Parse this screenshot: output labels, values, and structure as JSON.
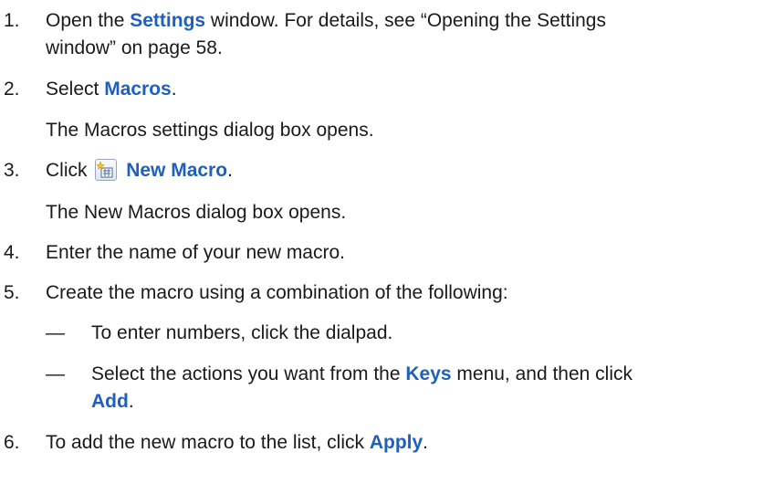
{
  "steps": [
    {
      "number": "1.",
      "pre": "Open the ",
      "ui": "Settings",
      "line1_post": " window. For details, see “Opening the Settings",
      "line2": "window” on page 58."
    },
    {
      "number": "2.",
      "pre": "Select ",
      "ui": "Macros",
      "post": ".",
      "result": "The Macros settings dialog box opens."
    },
    {
      "number": "3.",
      "pre": "Click ",
      "icon": "new-macro-icon",
      "ui": "New Macro",
      "post": ".",
      "result": "The New Macros dialog box opens."
    },
    {
      "number": "4.",
      "text": "Enter the name of your new macro."
    },
    {
      "number": "5.",
      "text": "Create the macro using a combination of the following:",
      "bullets": [
        {
          "dash": "—",
          "text": "To enter numbers, click the dialpad."
        },
        {
          "dash": "—",
          "pre": "Select the actions you want from the ",
          "ui": "Keys",
          "mid": " menu, and then click",
          "ui2": "Add",
          "post": "."
        }
      ]
    },
    {
      "number": "6.",
      "pre": "To add the new macro to the list, click ",
      "ui": "Apply",
      "post": "."
    }
  ],
  "colors": {
    "ui_link": "#1f5fbf",
    "text": "#1a1a1a"
  }
}
